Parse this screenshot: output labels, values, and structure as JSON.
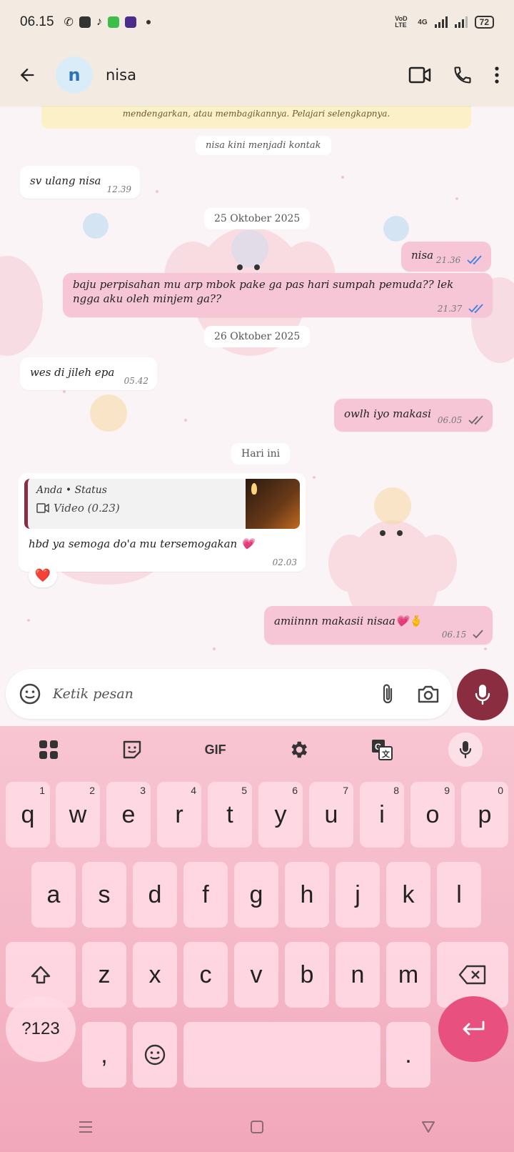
{
  "status_bar": {
    "time": "06.15",
    "network": "VoD LTE",
    "network_gen": "4G",
    "battery": "72"
  },
  "header": {
    "avatar_letter": "n",
    "contact_name": "nisa"
  },
  "chat": {
    "encryption_notice": "Pesan dan panggilan terenkripsi secara end-to-end. Hanya orang di chat ini yang bisa membaca, mendengarkan, atau membagikannya. Pelajari selengkapnya.",
    "encryption_notice_line2": "mendengarkan, atau membagikannya. Pelajari selengkapnya.",
    "system_contact": "nisa kini menjadi kontak",
    "messages": [
      {
        "dir": "in",
        "text": "sv ulang nisa",
        "time": "12.39"
      },
      {
        "date": "25 Oktober 2025"
      },
      {
        "dir": "out",
        "text": "nisa",
        "time": "21.36",
        "ticks": "read"
      },
      {
        "dir": "out",
        "text": "baju perpisahan mu arp mbok pake ga pas hari sumpah pemuda?? lek ngga aku oleh minjem ga??",
        "time": "21.37",
        "ticks": "read"
      },
      {
        "date": "26 Oktober 2025"
      },
      {
        "dir": "in",
        "text": "wes di jileh epa",
        "time": "05.42"
      },
      {
        "dir": "out",
        "text": "owlh iyo makasi",
        "time": "06.05",
        "ticks": "delivered"
      },
      {
        "date": "Hari ini"
      },
      {
        "dir": "in",
        "reply_who": "Anda • Status",
        "reply_what": "Video (0.23)",
        "text": "hbd ya semoga do'a mu tersemogakan 💗",
        "time": "02.03",
        "reaction": "❤️"
      },
      {
        "dir": "out",
        "text": "amiinnn makasii nisaa💗🫰",
        "time": "06.15",
        "ticks": "sent"
      }
    ]
  },
  "input": {
    "placeholder": "Ketik pesan"
  },
  "keyboard": {
    "tools": [
      "apps-grid",
      "sticker",
      "GIF",
      "settings",
      "translate",
      "voice"
    ],
    "gif_label": "GIF",
    "row1": [
      {
        "k": "q",
        "h": "1"
      },
      {
        "k": "w",
        "h": "2"
      },
      {
        "k": "e",
        "h": "3"
      },
      {
        "k": "r",
        "h": "4"
      },
      {
        "k": "t",
        "h": "5"
      },
      {
        "k": "y",
        "h": "6"
      },
      {
        "k": "u",
        "h": "7"
      },
      {
        "k": "i",
        "h": "8"
      },
      {
        "k": "o",
        "h": "9"
      },
      {
        "k": "p",
        "h": "0"
      }
    ],
    "row2": [
      "a",
      "s",
      "d",
      "f",
      "g",
      "h",
      "j",
      "k",
      "l"
    ],
    "row3": [
      "z",
      "x",
      "c",
      "v",
      "b",
      "n",
      "m"
    ],
    "symbols_label": "?123",
    "comma": ",",
    "period": "."
  },
  "colors": {
    "header_bg": "#f3ebe2",
    "out_bubble": "#f7c6d6",
    "in_bubble": "#ffffff",
    "accent": "#8a2d41",
    "enter_key": "#e8517f",
    "read_ticks": "#3d7fe0"
  }
}
